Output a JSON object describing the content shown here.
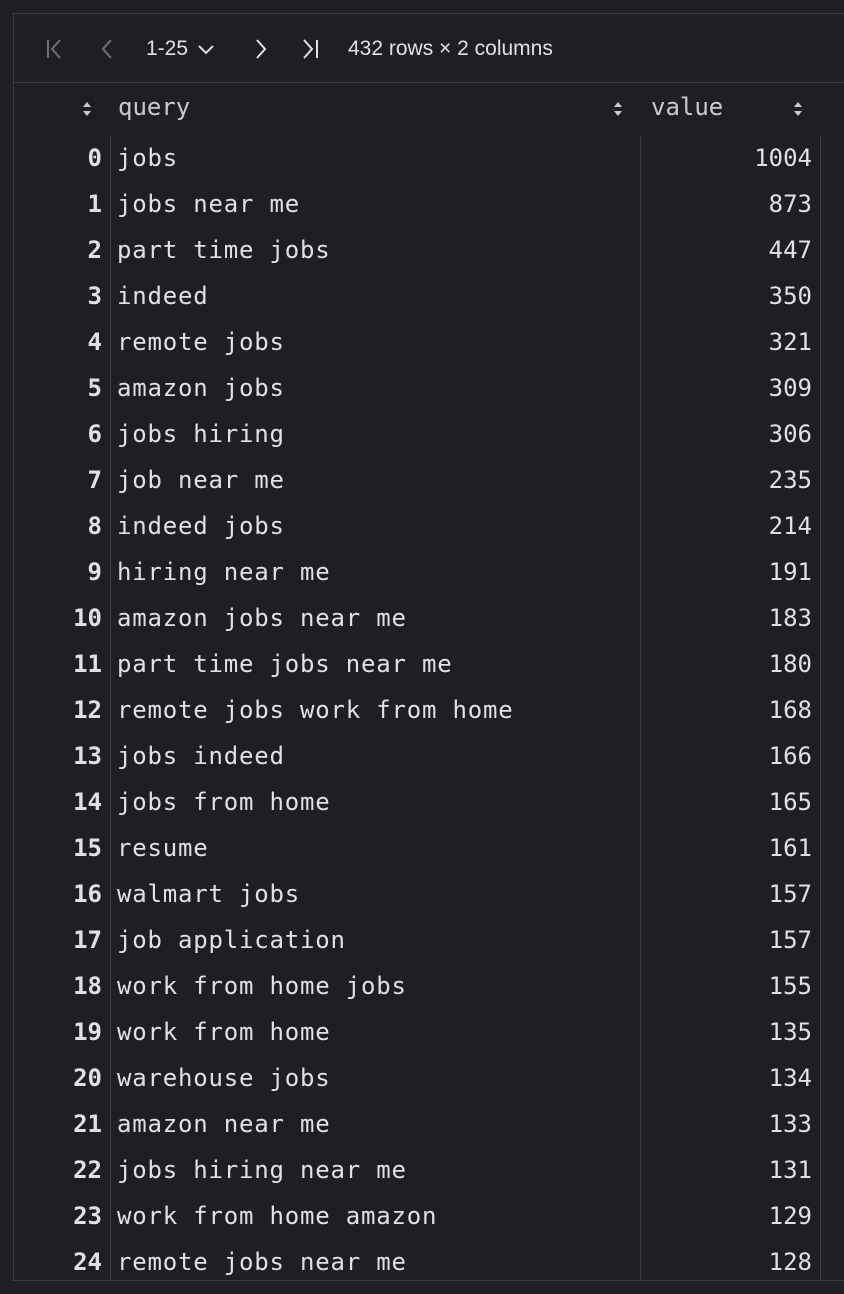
{
  "toolbar": {
    "first_page_icon": "first-page-icon",
    "prev_page_icon": "prev-page-icon",
    "page_range": "1-25",
    "page_dropdown_icon": "chevron-down-icon",
    "next_page_icon": "next-page-icon",
    "last_page_icon": "last-page-icon",
    "row_info": "432 rows × 2 columns"
  },
  "table": {
    "columns": [
      "query",
      "value"
    ],
    "rows": [
      {
        "index": "0",
        "query": "jobs",
        "value": "1004"
      },
      {
        "index": "1",
        "query": "jobs near me",
        "value": "873"
      },
      {
        "index": "2",
        "query": "part time jobs",
        "value": "447"
      },
      {
        "index": "3",
        "query": "indeed",
        "value": "350"
      },
      {
        "index": "4",
        "query": "remote jobs",
        "value": "321"
      },
      {
        "index": "5",
        "query": "amazon jobs",
        "value": "309"
      },
      {
        "index": "6",
        "query": "jobs hiring",
        "value": "306"
      },
      {
        "index": "7",
        "query": "job near me",
        "value": "235"
      },
      {
        "index": "8",
        "query": "indeed jobs",
        "value": "214"
      },
      {
        "index": "9",
        "query": "hiring near me",
        "value": "191"
      },
      {
        "index": "10",
        "query": "amazon jobs near me",
        "value": "183"
      },
      {
        "index": "11",
        "query": "part time jobs near me",
        "value": "180"
      },
      {
        "index": "12",
        "query": "remote jobs work from home",
        "value": "168"
      },
      {
        "index": "13",
        "query": "jobs indeed",
        "value": "166"
      },
      {
        "index": "14",
        "query": "jobs from home",
        "value": "165"
      },
      {
        "index": "15",
        "query": "resume",
        "value": "161"
      },
      {
        "index": "16",
        "query": "walmart jobs",
        "value": "157"
      },
      {
        "index": "17",
        "query": "job application",
        "value": "157"
      },
      {
        "index": "18",
        "query": "work from home jobs",
        "value": "155"
      },
      {
        "index": "19",
        "query": "work from home",
        "value": "135"
      },
      {
        "index": "20",
        "query": "warehouse jobs",
        "value": "134"
      },
      {
        "index": "21",
        "query": "amazon near me",
        "value": "133"
      },
      {
        "index": "22",
        "query": "jobs hiring near me",
        "value": "131"
      },
      {
        "index": "23",
        "query": "work from home amazon",
        "value": "129"
      },
      {
        "index": "24",
        "query": "remote jobs near me",
        "value": "128"
      }
    ]
  },
  "colors": {
    "background": "#1e1f22",
    "border": "#3a3b3f",
    "text": "#dfe1e5",
    "muted_icon": "#6f7177"
  }
}
